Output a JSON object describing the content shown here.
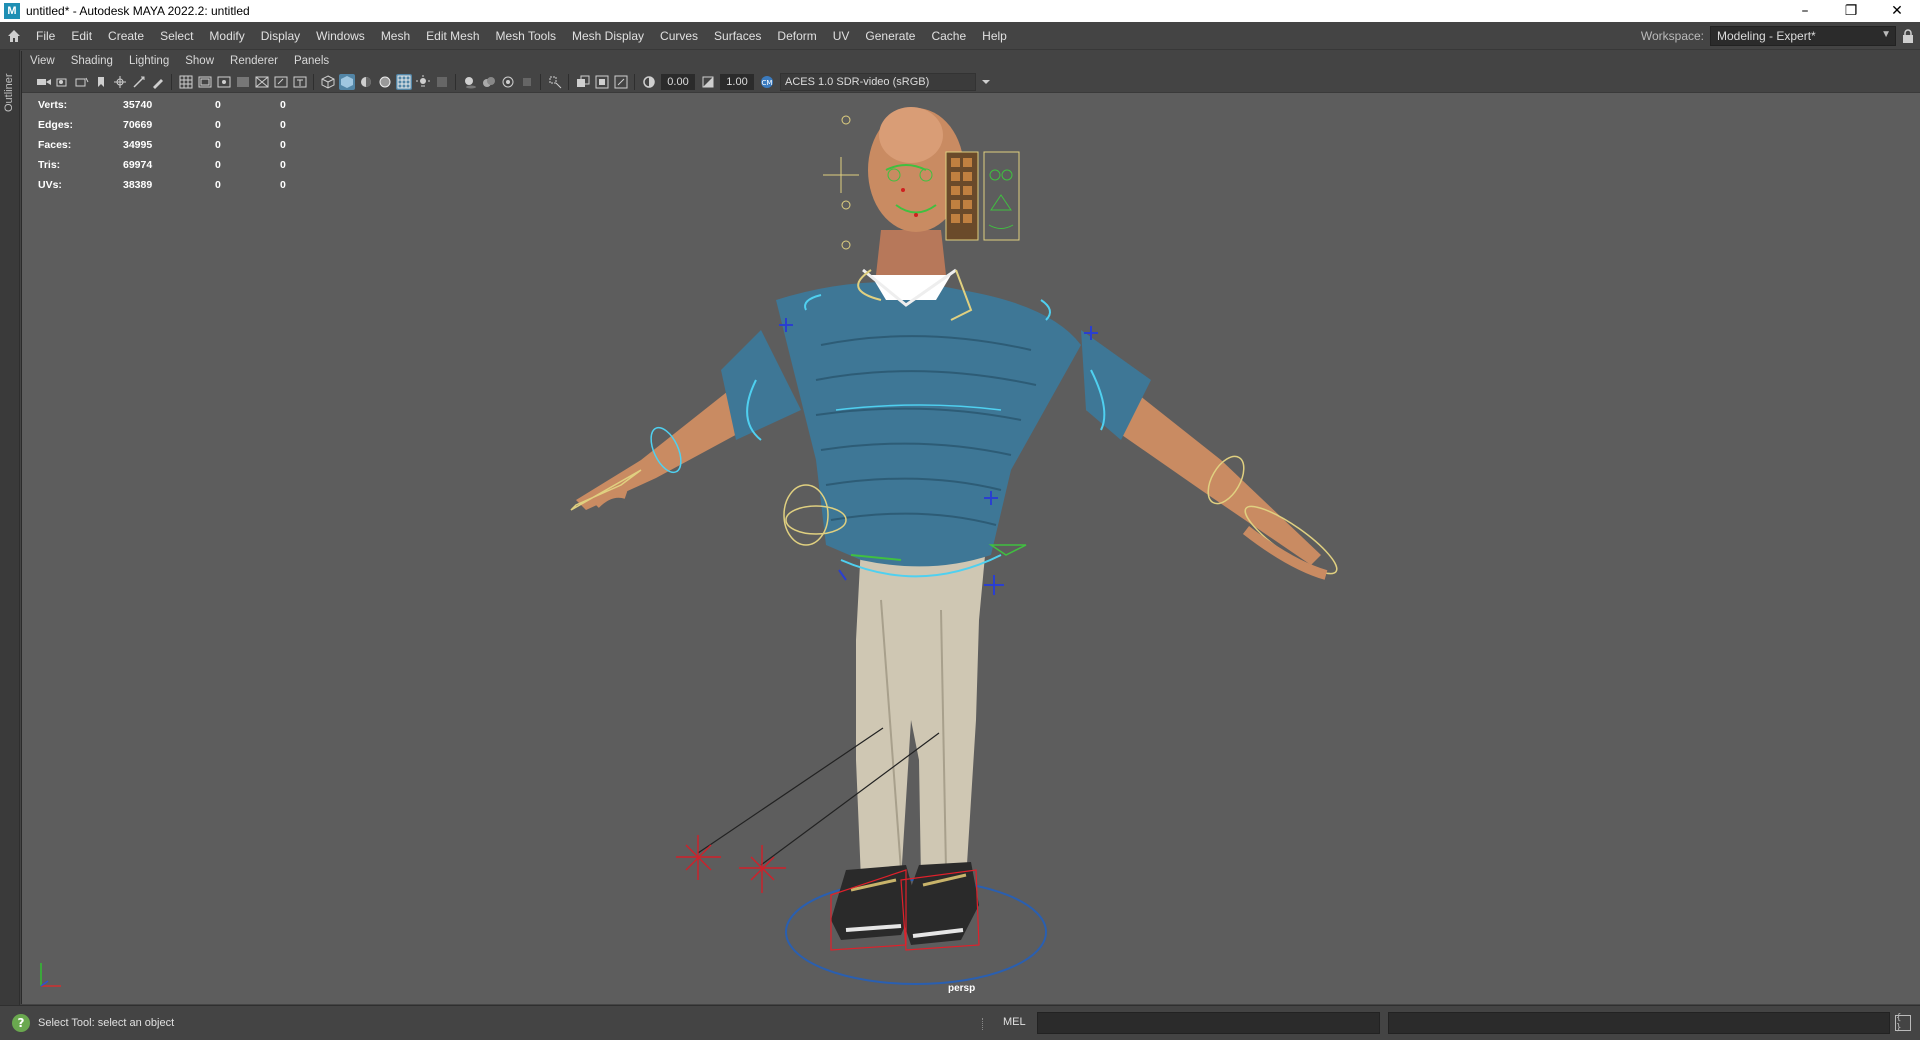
{
  "window": {
    "title": "untitled* - Autodesk MAYA 2022.2: untitled",
    "app_icon": "M"
  },
  "menubar": {
    "items": [
      "File",
      "Edit",
      "Create",
      "Select",
      "Modify",
      "Display",
      "Windows",
      "Mesh",
      "Edit Mesh",
      "Mesh Tools",
      "Mesh Display",
      "Curves",
      "Surfaces",
      "Deform",
      "UV",
      "Generate",
      "Cache",
      "Help"
    ],
    "workspace_label": "Workspace:",
    "workspace_value": "Modeling - Expert*"
  },
  "outliner": {
    "label": "Outliner"
  },
  "panel": {
    "menu": [
      "View",
      "Shading",
      "Lighting",
      "Show",
      "Renderer",
      "Panels"
    ],
    "toolbar": {
      "exposure": "0.00",
      "gamma": "1.00",
      "color_management": "ACES 1.0 SDR-video (sRGB)"
    },
    "hud": [
      {
        "label": "Verts:",
        "value": "35740",
        "a": "0",
        "b": "0"
      },
      {
        "label": "Edges:",
        "value": "70669",
        "a": "0",
        "b": "0"
      },
      {
        "label": "Faces:",
        "value": "34995",
        "a": "0",
        "b": "0"
      },
      {
        "label": "Tris:",
        "value": "69974",
        "a": "0",
        "b": "0"
      },
      {
        "label": "UVs:",
        "value": "38389",
        "a": "0",
        "b": "0"
      }
    ],
    "camera": "persp"
  },
  "statusbar": {
    "help_text": "Select Tool: select an object",
    "mel_label": "MEL"
  },
  "colors": {
    "viewport_bg": "#5d5d5d",
    "ui_bg": "#444444",
    "highlight": "#5285a6",
    "sweater": "#3e7796",
    "pants": "#cfc7b3",
    "skin": "#c98b62"
  }
}
